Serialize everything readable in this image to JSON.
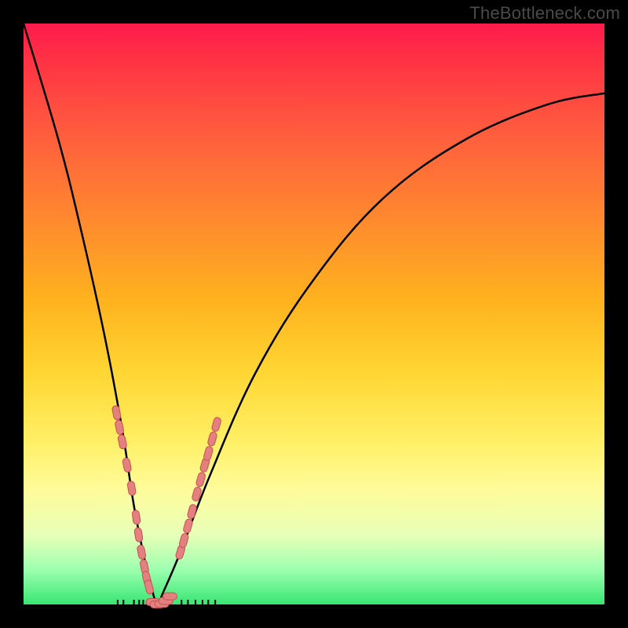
{
  "watermark": "TheBottleneck.com",
  "colors": {
    "frame": "#000000",
    "curve": "#000000",
    "tick_fill": "#e48080",
    "tick_stroke": "#c85050",
    "gradient_top": "#ff1a4d",
    "gradient_bottom": "#37e673"
  },
  "chart_data": {
    "type": "line",
    "title": "",
    "xlabel": "",
    "ylabel": "",
    "xlim": [
      0,
      100
    ],
    "ylim": [
      0,
      100
    ],
    "series": [
      {
        "name": "bottleneck-curve",
        "x": [
          0,
          6,
          10,
          14,
          17,
          19,
          21,
          22,
          23,
          24,
          27,
          32,
          40,
          50,
          62,
          76,
          90,
          100
        ],
        "y": [
          100,
          80,
          64,
          46,
          30,
          17,
          7,
          3,
          0,
          2,
          9,
          22,
          40,
          56,
          70,
          80,
          86,
          88
        ]
      }
    ],
    "tick_markers_left": {
      "comment": "pink capsule marks along left branch",
      "x": [
        16.0,
        16.5,
        17.0,
        17.8,
        18.6,
        19.4,
        19.8,
        20.3,
        20.8,
        21.2,
        21.6
      ],
      "y": [
        33,
        30.5,
        28,
        24,
        20,
        15,
        12,
        9,
        6.5,
        4.5,
        3
      ]
    },
    "tick_markers_right": {
      "comment": "pink capsule marks along right branch",
      "x": [
        27.0,
        27.6,
        28.3,
        29.0,
        29.8,
        30.5,
        31.2,
        31.8,
        32.5,
        33.2
      ],
      "y": [
        9,
        11,
        13.5,
        16,
        19,
        21.5,
        24,
        26,
        28.5,
        31
      ]
    },
    "tick_markers_bottom": {
      "comment": "pink capsule marks at trough",
      "x": [
        22.3,
        23.0,
        23.8,
        24.5,
        25.2
      ],
      "y": [
        0.4,
        0.0,
        0.1,
        0.6,
        1.4
      ]
    },
    "x_axis_ticks": [
      16.2,
      17.2,
      19.0,
      19.9,
      20.6,
      22.4,
      23.3,
      24.3,
      25.2,
      27.2,
      28.3,
      29.6,
      30.8,
      31.8,
      33.0
    ]
  }
}
